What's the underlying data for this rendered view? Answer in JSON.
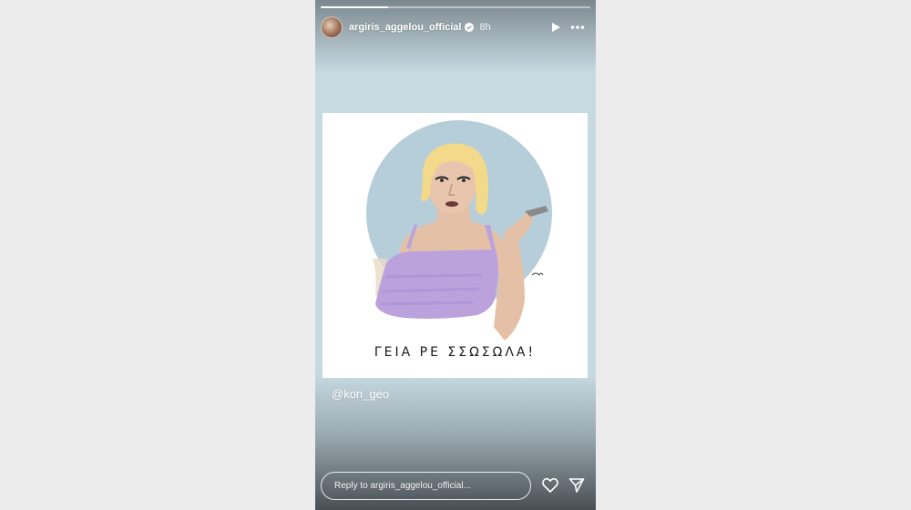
{
  "story": {
    "username": "argiris_aggelou_official",
    "time_ago": "8h",
    "progress": 0.25,
    "caption_art": "ΓΕΙΑ ΡΕ ΣΣΩΣΩΛΑ!",
    "mention": "@kon_geo",
    "reply_placeholder": "Reply to argiris_aggelou_official..."
  },
  "icons": {
    "play": "play-icon",
    "more": "more-options-icon",
    "like": "heart-icon",
    "share": "send-icon",
    "verified": "verified-badge-icon"
  },
  "colors": {
    "story_background": "#c7dae1",
    "card_background": "#ffffff",
    "art_circle": "#a9c6d3",
    "top_dress": "#bba2dd",
    "hair": "#f3d98a",
    "skin": "#e4c1a6"
  }
}
